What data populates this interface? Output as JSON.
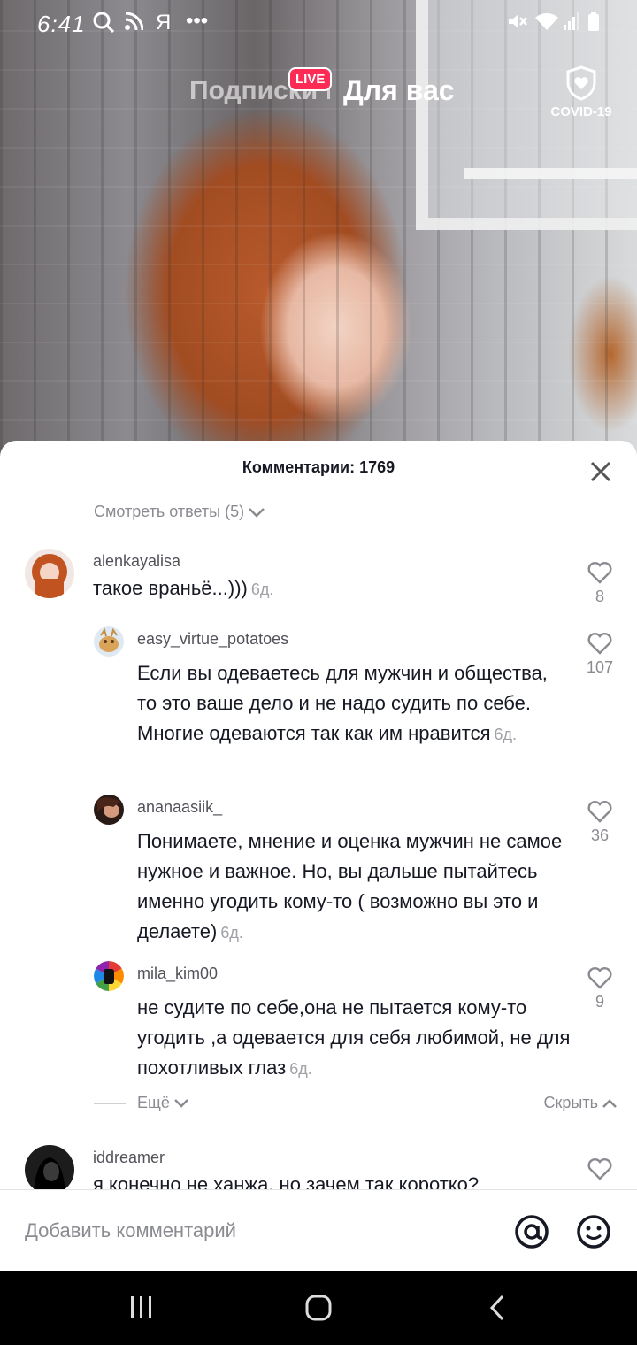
{
  "status_bar": {
    "time": "6:41",
    "icons": [
      "search-icon",
      "rss-icon",
      "yandex-icon",
      "more-dots-icon",
      "mute-icon",
      "wifi-icon",
      "signal-icon",
      "battery-icon"
    ],
    "yandex_glyph": "Я",
    "dots": "•••"
  },
  "top_nav": {
    "following_label": "Подписки",
    "live_badge": "LIVE",
    "for_you_label": "Для вас",
    "covid_label": "COVID-19"
  },
  "comments": {
    "title": "Комментарии: 1769",
    "view_replies": "Смотреть ответы (5)",
    "items": [
      {
        "username": "alenkayalisa",
        "text": "такое враньё...)))",
        "time": "6д.",
        "likes": "8"
      },
      {
        "username": "easy_virtue_potatoes",
        "text": "Если вы одеваетесь для мужчин и общества, то это ваше дело и не надо судить по себе. Многие одеваются так как им нравится",
        "time": "6д.",
        "likes": "107"
      },
      {
        "username": "ananaasiik_",
        "text": "Понимаете, мнение и оценка мужчин не самое нужное и важное. Но, вы дальше пытайтесь именно угодить кому-то ( возможно вы это и делаете)",
        "time": "6д.",
        "likes": "36"
      },
      {
        "username": "mila_kim00",
        "text": "не судите по себе,она не пытается кому-то угодить ,а одевается для себя любимой, не для похотливых глаз",
        "time": "6д.",
        "likes": "9"
      },
      {
        "username": "iddreamer",
        "text": "я конечно не ханжа, но зачем так коротко?",
        "time": "",
        "likes": ""
      }
    ],
    "more_label": "Ещё",
    "hide_label": "Скрыть"
  },
  "input": {
    "placeholder": "Добавить комментарий"
  },
  "colors": {
    "accent": "#fe2c55",
    "text": "#161823",
    "muted": "#8a8b91"
  }
}
